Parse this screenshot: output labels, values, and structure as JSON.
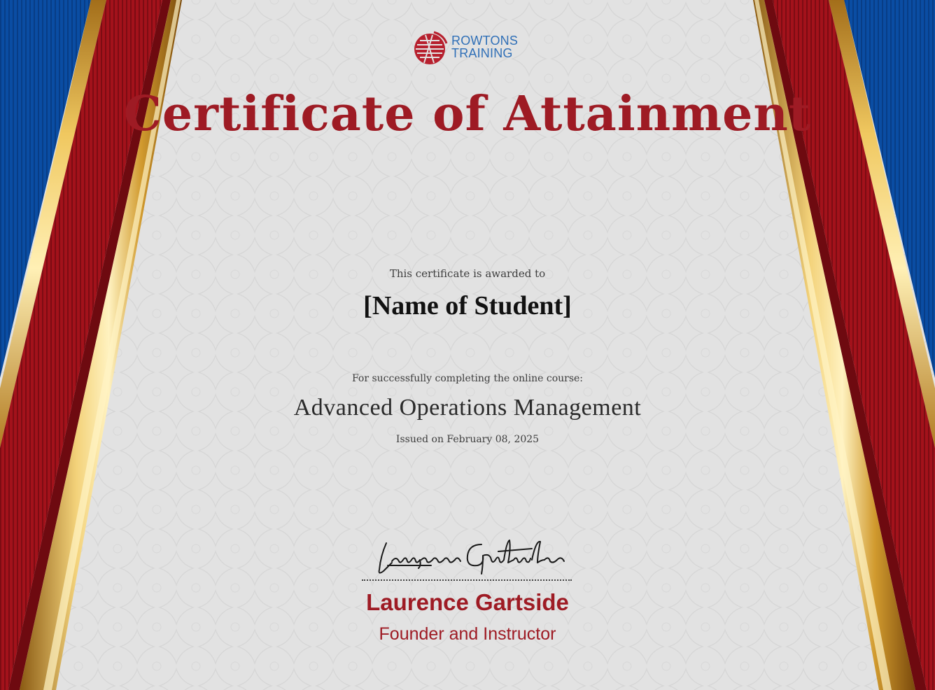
{
  "logo": {
    "line1": "ROWTONS",
    "line2": "TRAINING",
    "brand_color": "#2f6fb7",
    "mark_color": "#b7202e"
  },
  "certificate": {
    "title": "Certificate of Attainment",
    "awarded_text": "This certificate is awarded to",
    "student_name": "[Name of Student]",
    "completion_text": "For successfully completing the online course:",
    "course_name": "Advanced Operations Management",
    "issued_text": "Issued on February 08, 2025"
  },
  "signatory": {
    "signature_script": "Laurence Gartside",
    "name": "Laurence Gartside",
    "role": "Founder and Instructor"
  },
  "colors": {
    "title_red": "#9e1b24",
    "border_blue": "#0b4ea2",
    "border_red": "#a1141c",
    "border_gold": "#d9a93a",
    "background": "#e2e2e2"
  }
}
